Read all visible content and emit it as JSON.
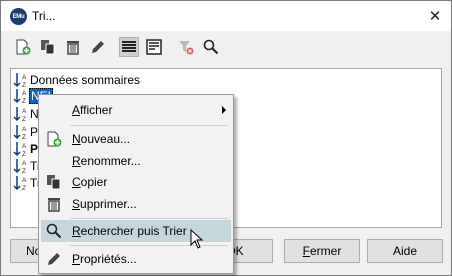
{
  "window": {
    "title": "Tri...",
    "app_icon_text": "EMu",
    "close_glyph": "✕"
  },
  "toolbar": {
    "icons": [
      "new-sort-icon",
      "copy-icon",
      "delete-icon",
      "edit-icon",
      "list-view-icon",
      "detail-view-icon",
      "clear-filter-icon",
      "search-icon"
    ]
  },
  "list": {
    "items": [
      {
        "label": "Données sommaires",
        "selected": false,
        "bold": false
      },
      {
        "label": "NEI",
        "selected": true,
        "bold": false
      },
      {
        "label": "No",
        "selected": false,
        "bold": false
      },
      {
        "label": "Pa",
        "selected": false,
        "bold": false
      },
      {
        "label": "Pr",
        "selected": false,
        "bold": true
      },
      {
        "label": "Tr",
        "selected": false,
        "bold": false
      },
      {
        "label": "Tr",
        "selected": false,
        "bold": false
      }
    ]
  },
  "buttons": {
    "new_label": "Nouv",
    "ok_label": "OK",
    "close_label": "Fermer",
    "close_accel": "F",
    "close_rest": "ermer",
    "help_label": "Aide"
  },
  "context_menu": {
    "items": [
      {
        "label": "Afficher",
        "icon": "",
        "accel": "A",
        "rest": "fficher",
        "submenu": true
      },
      {
        "label": "Nouveau...",
        "icon": "new-sort-icon",
        "accel": "N",
        "rest": "ouveau..."
      },
      {
        "label": "Renommer...",
        "icon": "",
        "accel": "R",
        "rest": "enommer..."
      },
      {
        "label": "Copier",
        "icon": "copy-icon",
        "accel": "C",
        "rest": "opier"
      },
      {
        "label": "Supprimer...",
        "icon": "delete-icon",
        "accel": "S",
        "rest": "upprimer..."
      },
      {
        "label": "Rechercher puis Trier",
        "icon": "search-icon",
        "accel": "R",
        "rest": "echercher puis Trier",
        "hover": true
      },
      {
        "label": "Propriétés...",
        "icon": "edit-icon",
        "accel": "P",
        "rest": "ropriétés..."
      }
    ]
  },
  "colors": {
    "selection": "#0a64c8",
    "menu_hover": "#c6d7dc",
    "accent_green": "#3aa63a",
    "accent_blue": "#2f6fd0"
  }
}
